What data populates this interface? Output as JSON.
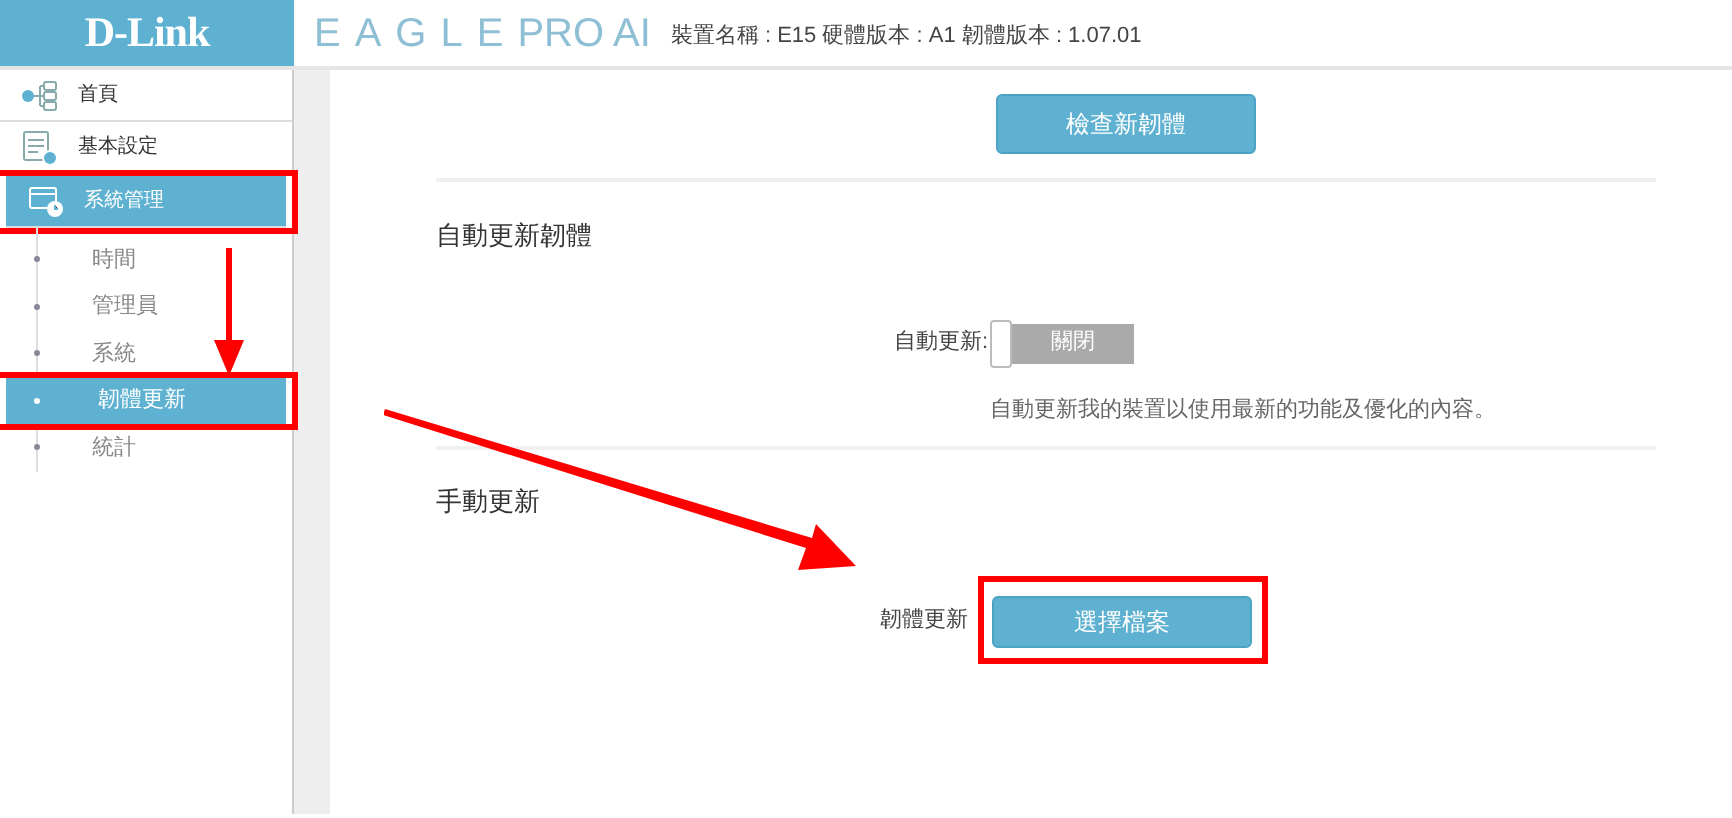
{
  "header": {
    "logo": "D-Link",
    "product_main": "EAGLE",
    "product_sub": "PRO AI",
    "device_info": "裝置名稱 : E15 硬體版本 : A1 韌體版本 : 1.07.01"
  },
  "sidebar": {
    "items": [
      {
        "label": "首頁",
        "selected": false,
        "highlighted": false
      },
      {
        "label": "基本設定",
        "selected": false,
        "highlighted": false
      },
      {
        "label": "系統管理",
        "selected": true,
        "highlighted": true,
        "children": [
          {
            "label": "時間",
            "selected": false,
            "highlighted": false
          },
          {
            "label": "管理員",
            "selected": false,
            "highlighted": false
          },
          {
            "label": "系統",
            "selected": false,
            "highlighted": false
          },
          {
            "label": "韌體更新",
            "selected": true,
            "highlighted": true
          },
          {
            "label": "統計",
            "selected": false,
            "highlighted": false
          }
        ]
      }
    ]
  },
  "check_button": {
    "label": "檢查新韌體"
  },
  "auto_section": {
    "title": "自動更新韌體",
    "label": "自動更新:",
    "on": false,
    "toggle_text": "關閉",
    "description": "自動更新我的裝置以使用最新的功能及優化的內容。"
  },
  "manual_section": {
    "title": "手動更新",
    "label": "韌體更新",
    "button": {
      "label": "選擇檔案",
      "highlighted": true
    }
  }
}
